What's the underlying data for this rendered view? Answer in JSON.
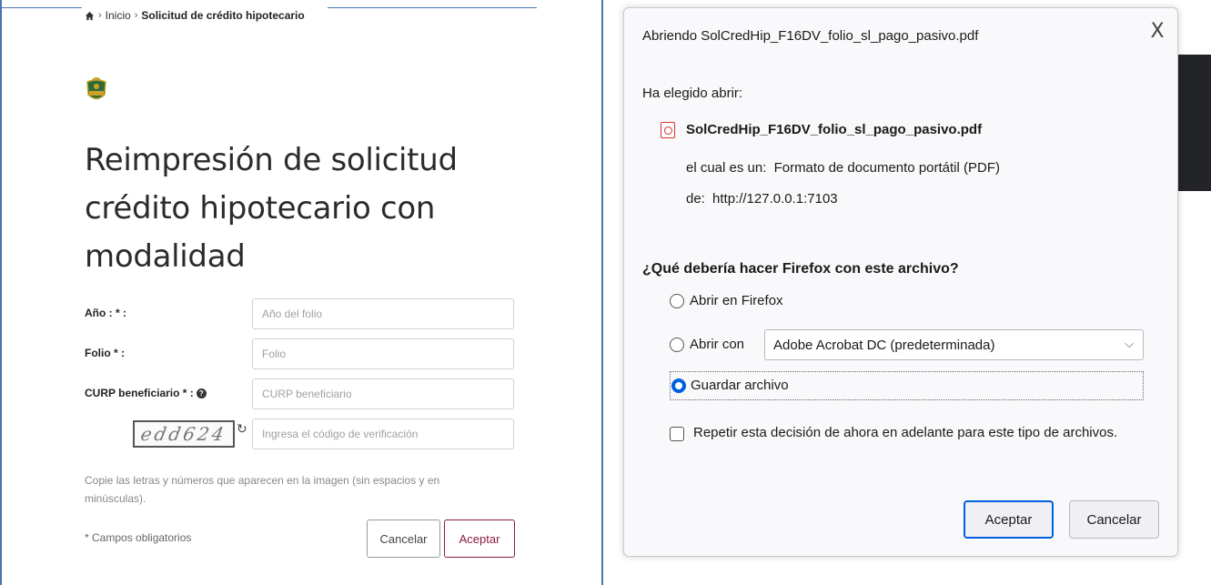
{
  "left": {
    "breadcrumb": {
      "home_icon": "home-icon",
      "separator": "›",
      "inicio": "Inicio",
      "current": "Solicitud de crédito hipotecario"
    },
    "logo_icon": "issfam-shield-logo",
    "title": "Reimpresión de solicitud crédito hipotecario con modalidad",
    "fields": [
      {
        "label": "Año : * :",
        "placeholder": "Año del folio",
        "value": ""
      },
      {
        "label": "Folio * :",
        "placeholder": "Folio",
        "value": ""
      },
      {
        "label": "CURP beneficiario * :",
        "placeholder": "CURP beneficiario",
        "value": "",
        "help_icon": "?"
      }
    ],
    "captcha": {
      "code": "edd624",
      "refresh_icon": "↻",
      "placeholder": "Ingresa el código de verificación"
    },
    "hint": "Copie las letras y números que aparecen en la imagen (sin espacios y en minúsculas).",
    "required_note": "* Campos obligatorios",
    "buttons": {
      "cancel": "Cancelar",
      "accept": "Aceptar"
    },
    "colors": {
      "accent": "#8a1c3c",
      "panel_border": "#4b73b5"
    }
  },
  "dialog": {
    "title": "Abriendo SolCredHip_F16DV_folio_sl_pago_pasivo.pdf",
    "close": "X",
    "chosen_label": "Ha elegido abrir:",
    "file_icon": "pdf-icon",
    "file_name": "SolCredHip_F16DV_folio_sl_pago_pasivo.pdf",
    "type_label": "el cual es un:",
    "type_value": "Formato de documento portátil (PDF)",
    "from_label": "de:",
    "from_value": "http://127.0.0.1:7103",
    "question": "¿Qué debería hacer Firefox con este archivo?",
    "options": {
      "open_in_firefox": {
        "label": "Abrir en Firefox",
        "checked": false
      },
      "open_with": {
        "label": "Abrir con",
        "checked": false
      },
      "save_file": {
        "label": "Guardar archivo",
        "checked": true
      }
    },
    "open_with_app": "Adobe Acrobat DC (predeterminada)",
    "dropdown_arrow": "⌵",
    "remember": {
      "label": "Repetir esta decisión de ahora en adelante para este tipo de archivos.",
      "checked": false
    },
    "buttons": {
      "accept": "Aceptar",
      "cancel": "Cancelar"
    },
    "colors": {
      "primary": "#0060df"
    }
  }
}
